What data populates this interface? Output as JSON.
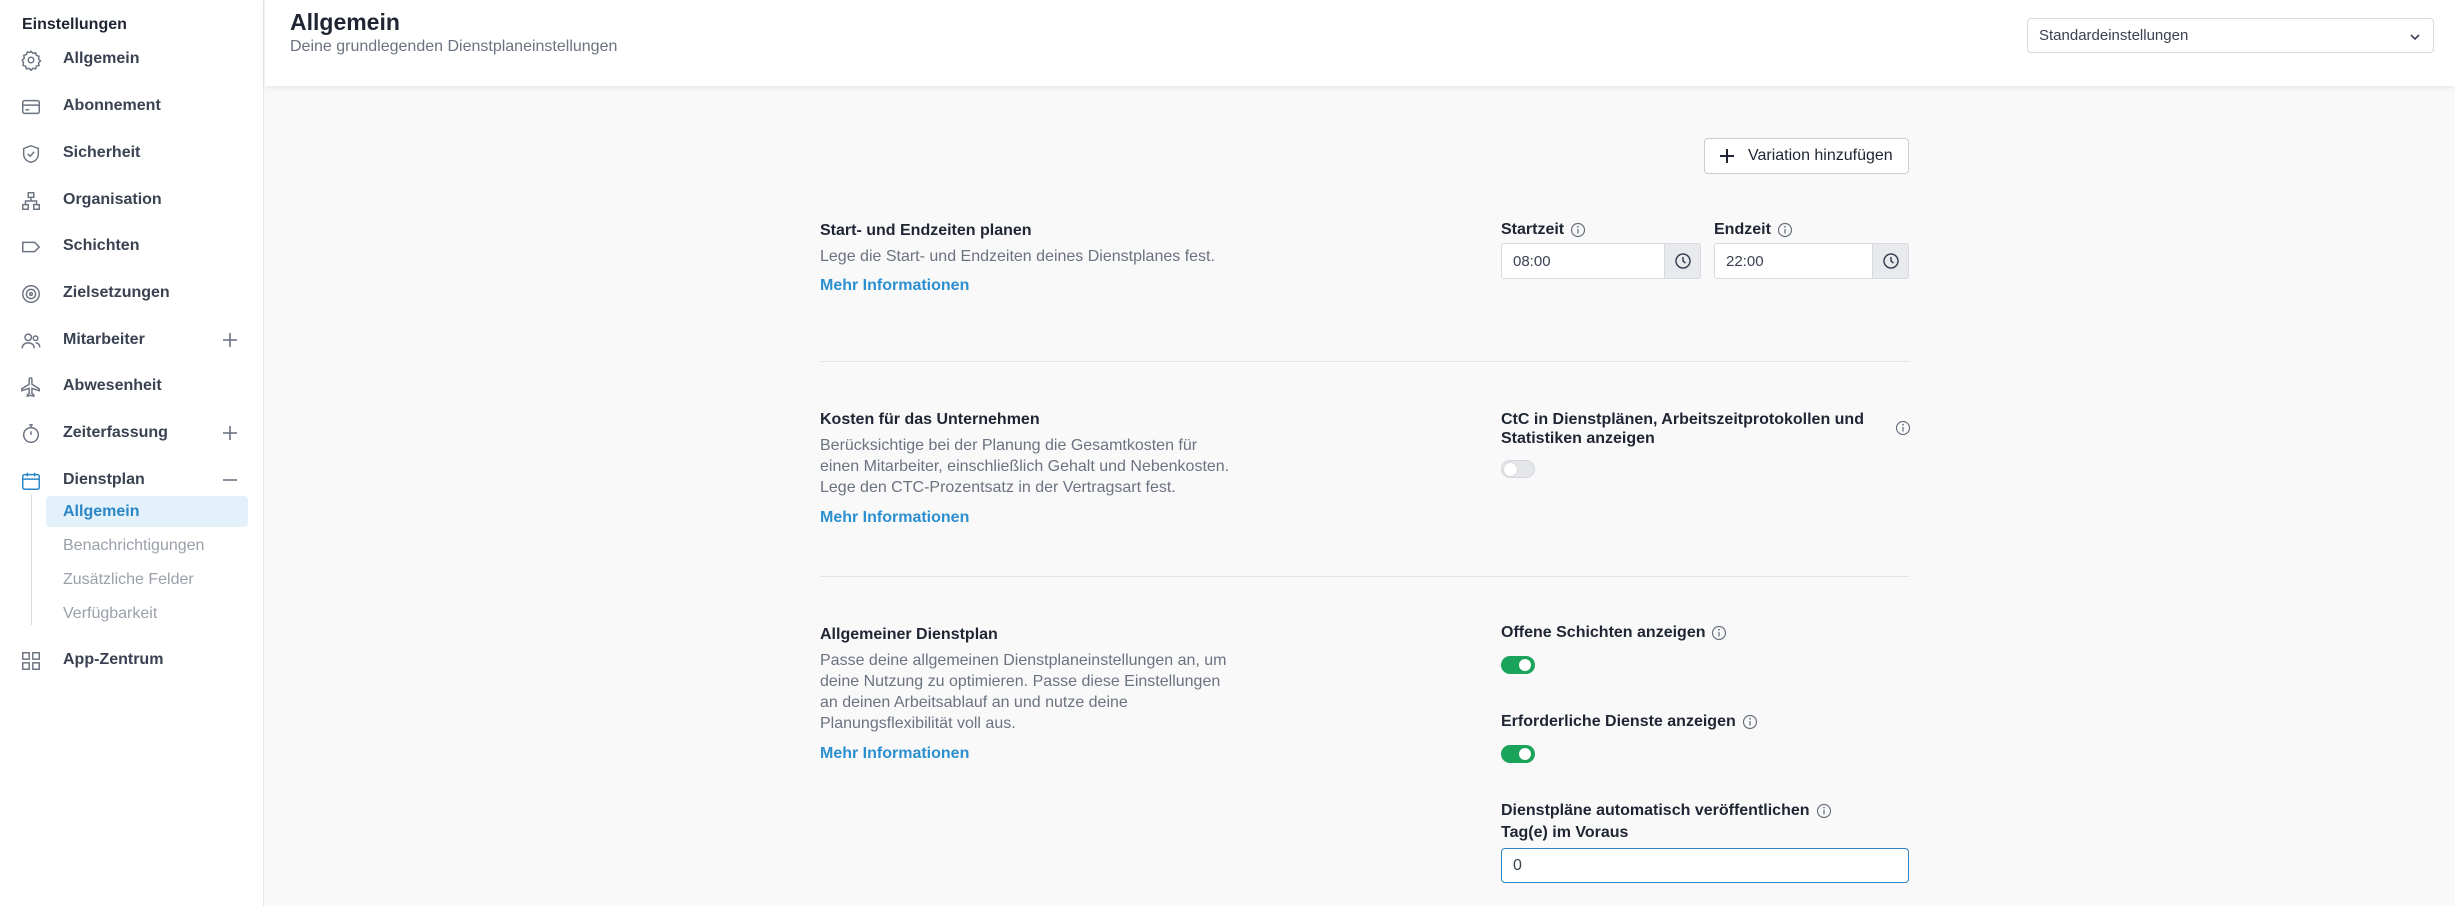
{
  "sidebar": {
    "title": "Einstellungen",
    "items": [
      {
        "label": "Allgemein",
        "icon": "gear-icon"
      },
      {
        "label": "Abonnement",
        "icon": "credit-card-icon"
      },
      {
        "label": "Sicherheit",
        "icon": "shield-icon"
      },
      {
        "label": "Organisation",
        "icon": "org-chart-icon"
      },
      {
        "label": "Schichten",
        "icon": "tag-icon"
      },
      {
        "label": "Zielsetzungen",
        "icon": "target-icon"
      },
      {
        "label": "Mitarbeiter",
        "icon": "users-icon"
      },
      {
        "label": "Abwesenheit",
        "icon": "plane-icon"
      },
      {
        "label": "Zeiterfassung",
        "icon": "stopwatch-icon"
      },
      {
        "label": "Dienstplan",
        "icon": "calendar-icon"
      },
      {
        "label": "App-Zentrum",
        "icon": "grid-icon"
      }
    ],
    "dienstplan_sub": [
      {
        "label": "Allgemein",
        "active": true
      },
      {
        "label": "Benachrichtigungen",
        "active": false
      },
      {
        "label": "Zusätzliche Felder",
        "active": false
      },
      {
        "label": "Verfügbarkeit",
        "active": false
      }
    ]
  },
  "header": {
    "title": "Allgemein",
    "subtitle": "Deine grundlegenden Dienstplaneinstellungen",
    "select_value": "Standardeinstellungen"
  },
  "main": {
    "variation_button": "Variation hinzufügen",
    "section_times": {
      "title": "Start- und Endzeiten planen",
      "description": "Lege die Start- und Endzeiten deines Dienstplanes fest.",
      "link": "Mehr Informationen",
      "start_label": "Startzeit",
      "start_value": "08:00",
      "end_label": "Endzeit",
      "end_value": "22:00"
    },
    "section_costs": {
      "title": "Kosten für das Unternehmen",
      "desc_line1": "Berücksichtige bei der Planung die Gesamtkosten für",
      "desc_line2": "einen Mitarbeiter, einschließlich Gehalt und Nebenkosten.",
      "desc_line3": "Lege den CTC-Prozentsatz in der Vertragsart fest.",
      "link": "Mehr Informationen",
      "toggle_label_line1": "CtC in Dienstplänen, Arbeitszeitprotokollen und",
      "toggle_label_line2": "Statistiken anzeigen",
      "toggle_on": false
    },
    "section_general": {
      "title": "Allgemeiner Dienstplan",
      "desc_line1": "Passe deine allgemeinen Dienstplaneinstellungen an, um",
      "desc_line2": "deine Nutzung zu optimieren. Passe diese Einstellungen",
      "desc_line3": "an deinen Arbeitsablauf an und nutze deine",
      "desc_line4": "Planungsflexibilität voll aus.",
      "link": "Mehr Informationen",
      "open_shifts_label": "Offene Schichten anzeigen",
      "open_shifts_on": true,
      "required_label": "Erforderliche Dienste anzeigen",
      "required_on": true,
      "auto_publish_label": "Dienstpläne automatisch veröffentlichen",
      "days_ahead_label": "Tag(e) im Voraus",
      "days_ahead_value": "0"
    }
  },
  "colors": {
    "accent": "#2b86c5",
    "link": "#2b8fd0",
    "toggle_on": "#1aa35a",
    "active_bg": "#e3f1fb"
  }
}
